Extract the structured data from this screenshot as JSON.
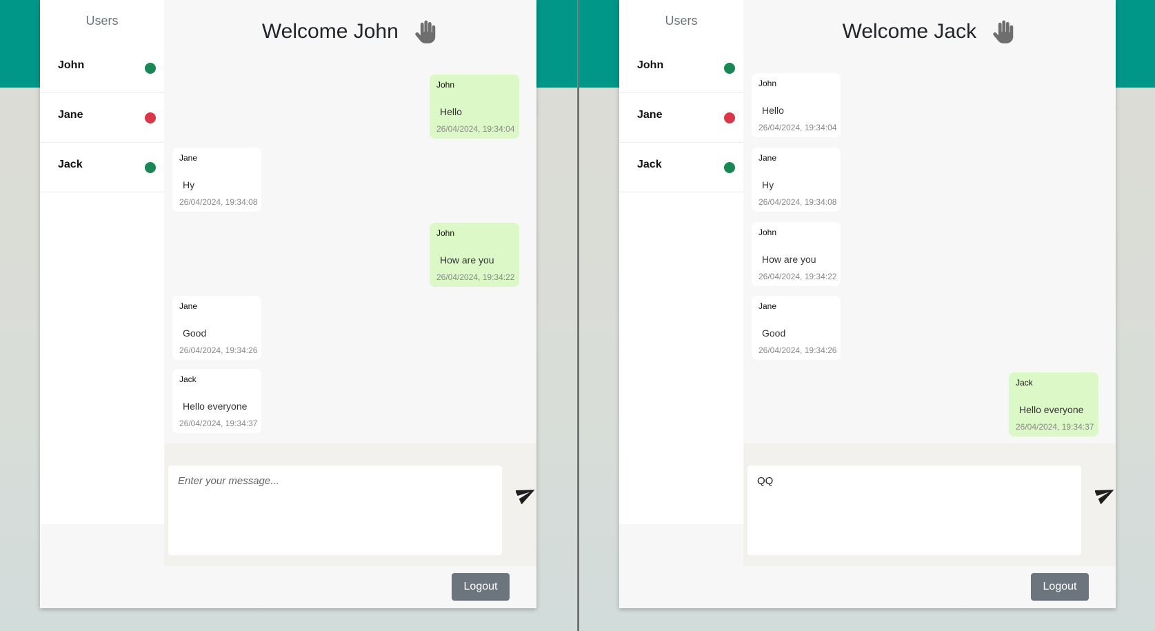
{
  "colors": {
    "online": "#198754",
    "offline": "#dc3545",
    "accent": "#009688"
  },
  "left": {
    "sidebar_title": "Users",
    "users": [
      {
        "name": "John",
        "status": "online"
      },
      {
        "name": "Jane",
        "status": "offline"
      },
      {
        "name": "Jack",
        "status": "online"
      }
    ],
    "welcome": "Welcome John",
    "welcome_icon": "hand-wave-icon",
    "messages": [
      {
        "sender": "John",
        "text": "Hello",
        "time": "26/04/2024, 19:34:04",
        "mine": true
      },
      {
        "sender": "Jane",
        "text": "Hy",
        "time": "26/04/2024, 19:34:08",
        "mine": false
      },
      {
        "sender": "John",
        "text": "How are you",
        "time": "26/04/2024, 19:34:22",
        "mine": true
      },
      {
        "sender": "Jane",
        "text": "Good",
        "time": "26/04/2024, 19:34:26",
        "mine": false
      },
      {
        "sender": "Jack",
        "text": "Hello everyone",
        "time": "26/04/2024, 19:34:37",
        "mine": false
      }
    ],
    "input_value": "",
    "input_placeholder": "Enter your message...",
    "logout_label": "Logout"
  },
  "right": {
    "sidebar_title": "Users",
    "users": [
      {
        "name": "John",
        "status": "online"
      },
      {
        "name": "Jane",
        "status": "offline"
      },
      {
        "name": "Jack",
        "status": "online"
      }
    ],
    "welcome": "Welcome Jack",
    "welcome_icon": "hand-wave-icon",
    "messages": [
      {
        "sender": "John",
        "text": "Hello",
        "time": "26/04/2024, 19:34:04",
        "mine": false
      },
      {
        "sender": "Jane",
        "text": "Hy",
        "time": "26/04/2024, 19:34:08",
        "mine": false
      },
      {
        "sender": "John",
        "text": "How are you",
        "time": "26/04/2024, 19:34:22",
        "mine": false
      },
      {
        "sender": "Jane",
        "text": "Good",
        "time": "26/04/2024, 19:34:26",
        "mine": false
      },
      {
        "sender": "Jack",
        "text": "Hello everyone",
        "time": "26/04/2024, 19:34:37",
        "mine": true
      }
    ],
    "input_value": "QQ",
    "input_placeholder": "Enter your message...",
    "logout_label": "Logout"
  }
}
